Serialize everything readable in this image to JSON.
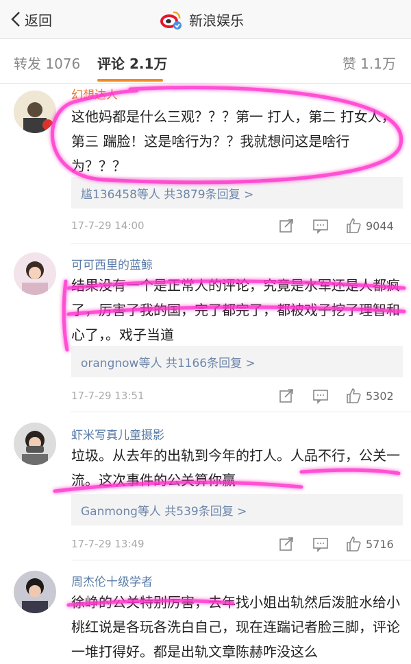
{
  "header": {
    "back_label": "返回",
    "title": "新浪娱乐"
  },
  "tabs": {
    "repost": "转发 1076",
    "comment": "评论 2.1万",
    "like": "赞 1.1万"
  },
  "comments": [
    {
      "user": "幻想达人",
      "text": "这他妈都是什么三观？？？第一 打人，第二 打女人，第三 踹脸！这是啥行为？？我就想问这是啥行为？？？",
      "replies": "尴136458等人  共3879条回复 >",
      "time": "17-7-29 14:00",
      "likes": "9044"
    },
    {
      "user": "可可西里的蓝鲸",
      "text": "结果没有一个是正常人的评论，究竟是水军还是人都疯了，厉害了我的国，完了都完了，都被戏子挖了理智和心了，。戏子当道",
      "replies": "orangnow等人  共1166条回复 >",
      "time": "17-7-29 13:51",
      "likes": "5302"
    },
    {
      "user": "虾米写真儿童摄影",
      "text": "垃圾。从去年的出轨到今年的打人。人品不行，公关一流。这次事件的公关算你赢",
      "replies": "Ganmong等人  共539条回复 >",
      "time": "17-7-29 13:49",
      "likes": "5716"
    },
    {
      "user": "周杰伦十级学者",
      "text": "徐峥的公关特别厉害，去年找小姐出轨然后泼脏水给小桃红说是各玩各洗白自己，现在连踹记者脸三脚，评论一堆打得好。都是出轨文章陈赫咋没这么",
      "replies": "",
      "time": "",
      "likes": ""
    }
  ],
  "colors": {
    "accent": "#f08a24",
    "link": "#5b7da8",
    "highlighter": "#ff33cc"
  }
}
